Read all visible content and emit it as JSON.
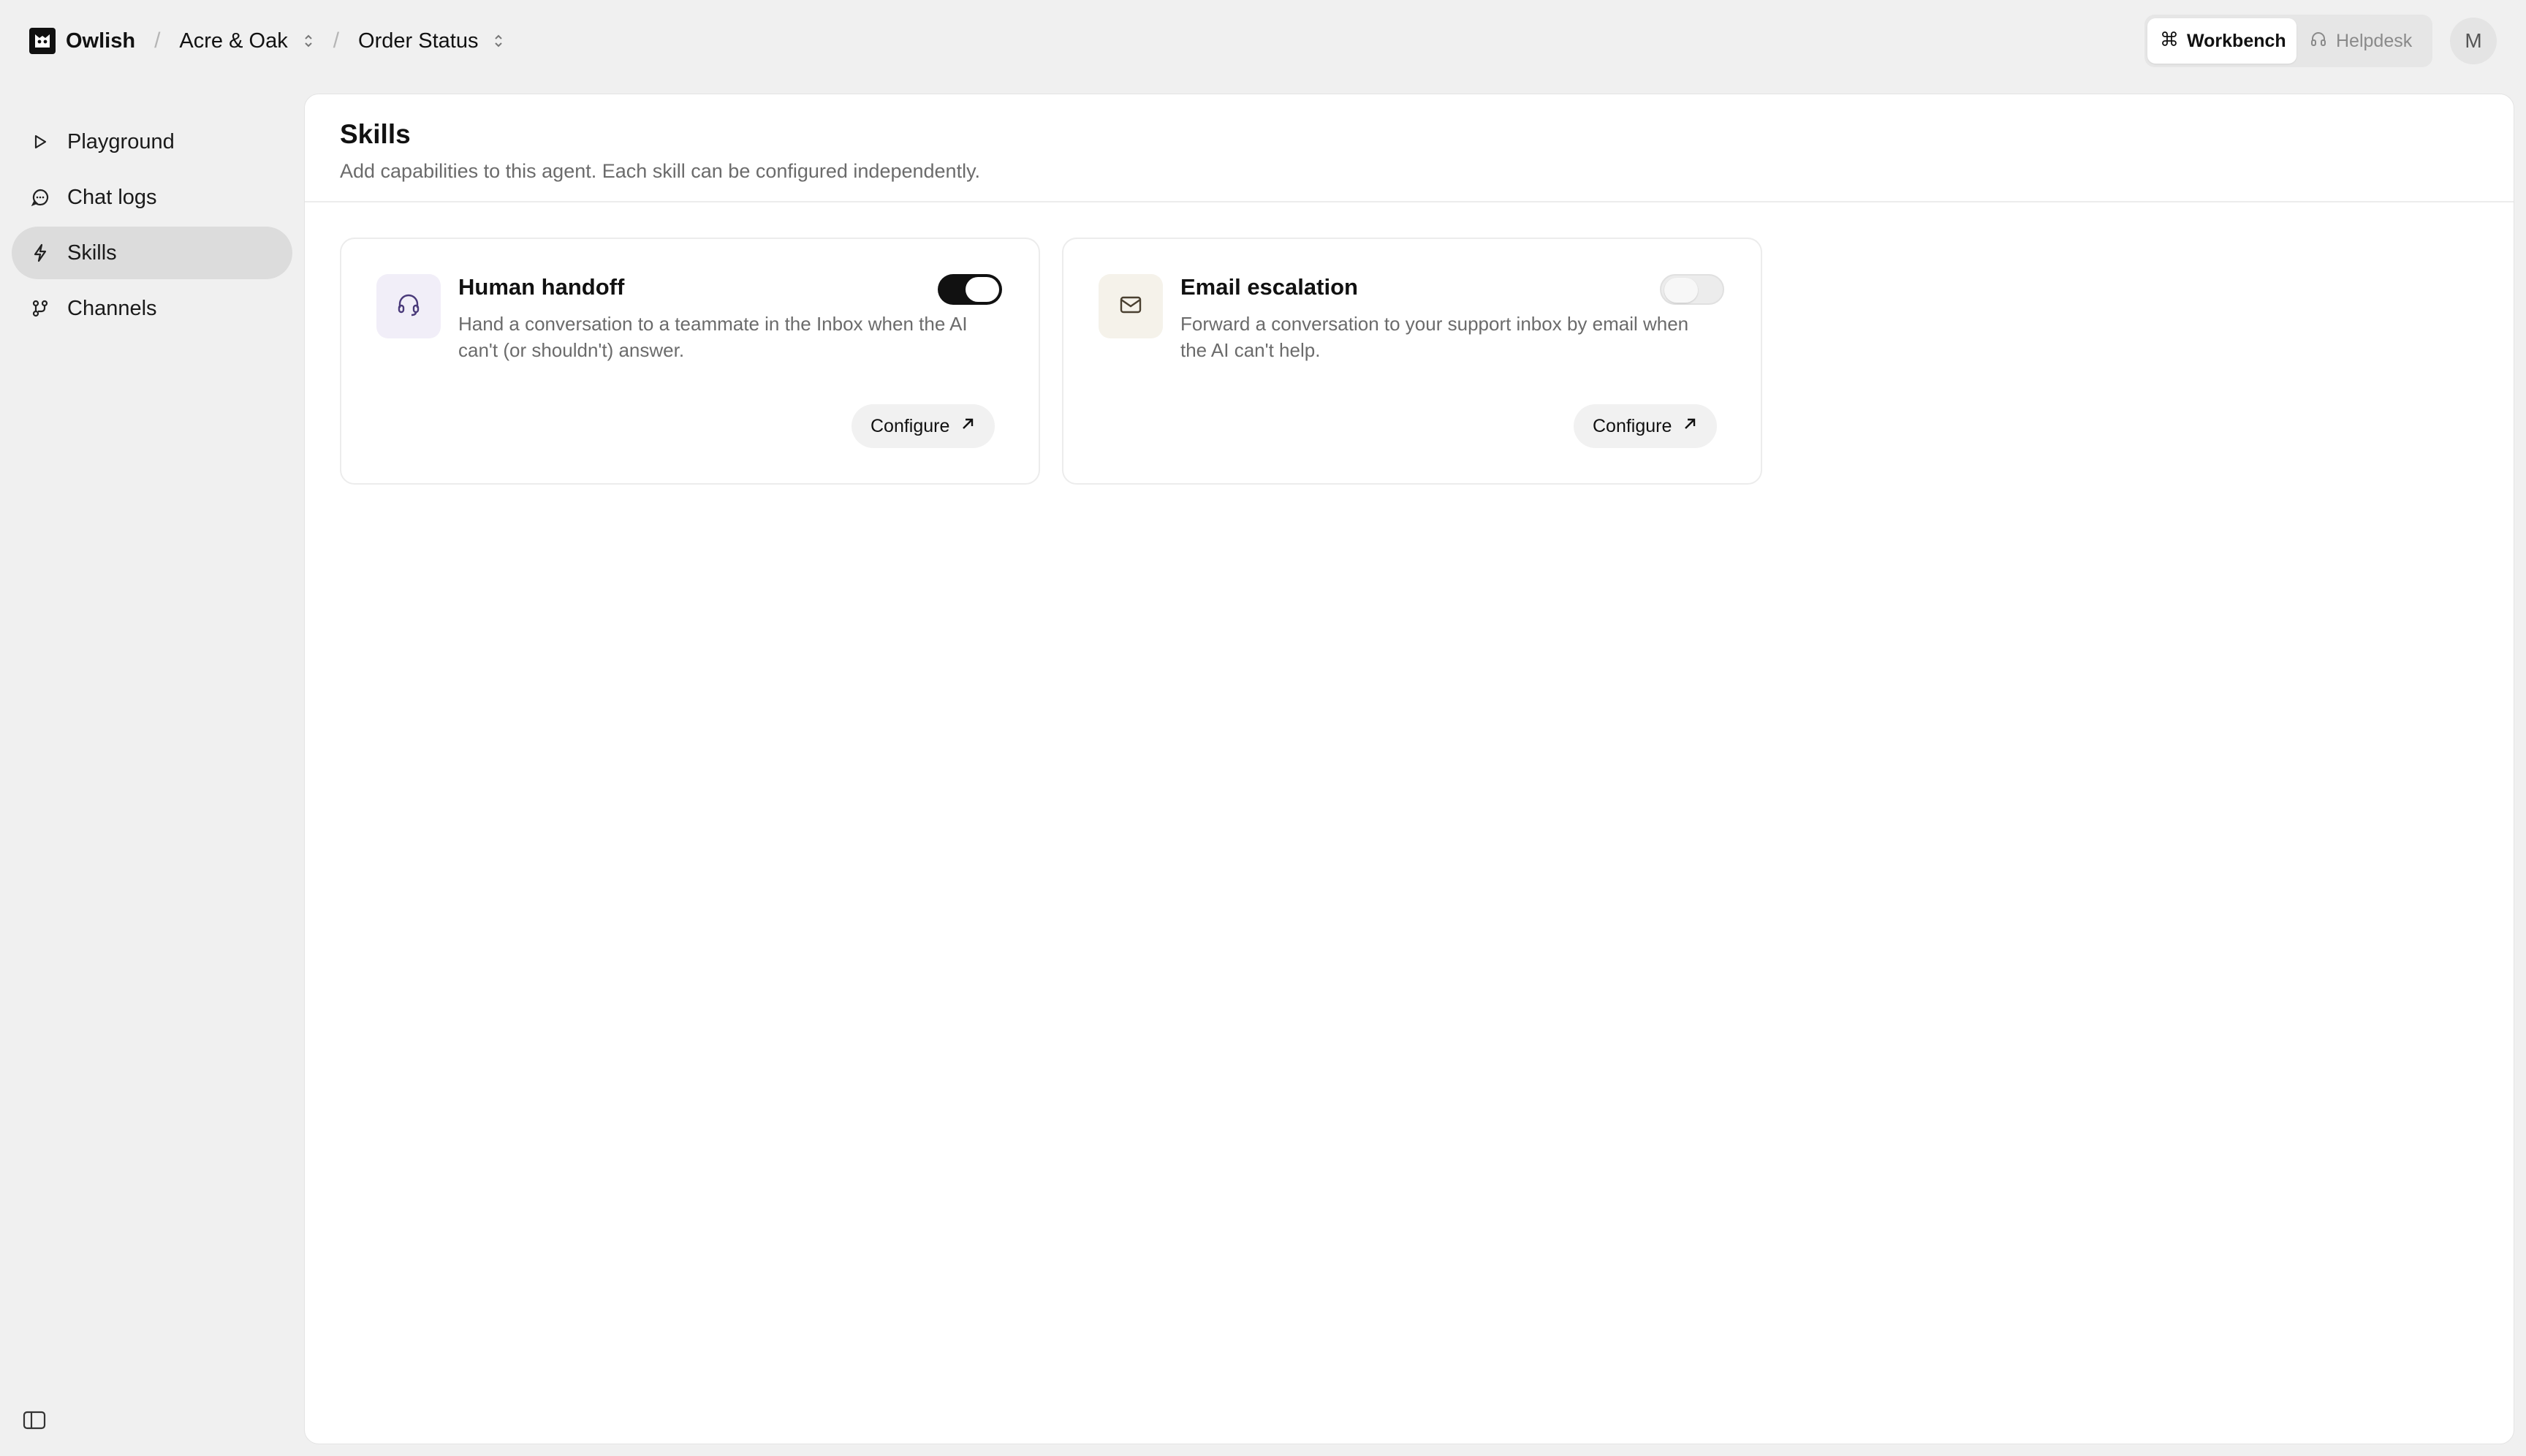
{
  "breadcrumb": {
    "app": "Owlish",
    "workspace": "Acre & Oak",
    "page": "Order Status",
    "separator": "/"
  },
  "switcher": {
    "items": [
      {
        "label": "Workbench",
        "icon": "command-icon",
        "active": true
      },
      {
        "label": "Helpdesk",
        "icon": "headphones-icon",
        "active": false
      }
    ]
  },
  "avatar": {
    "initial": "M"
  },
  "sidebar": {
    "items": [
      {
        "label": "Playground",
        "icon": "play-icon",
        "active": false
      },
      {
        "label": "Chat logs",
        "icon": "chat-icon",
        "active": false
      },
      {
        "label": "Skills",
        "icon": "lightning-icon",
        "active": true
      },
      {
        "label": "Channels",
        "icon": "channels-icon",
        "active": false
      }
    ]
  },
  "main": {
    "title": "Skills",
    "subtitle": "Add capabilities to this agent. Each skill can be configured independently."
  },
  "skills": [
    {
      "title": "Human handoff",
      "description": "Hand a conversation to a teammate in the Inbox when the AI can't (or shouldn't) answer.",
      "enabled": true,
      "icon": "headset-icon",
      "icon_bg": "#f1eef8",
      "icon_color": "#4a3a7a",
      "configure_label": "Configure"
    },
    {
      "title": "Email escalation",
      "description": "Forward a conversation to your support inbox by email when the AI can't help.",
      "enabled": false,
      "icon": "mail-icon",
      "icon_bg": "#f5f2ea",
      "icon_color": "#4a4030",
      "configure_label": "Configure"
    }
  ]
}
